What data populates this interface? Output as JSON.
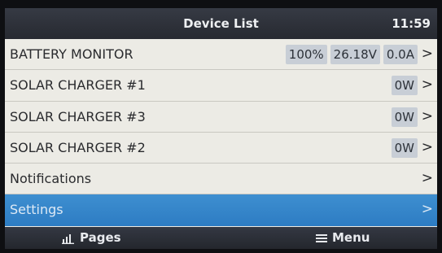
{
  "header": {
    "title": "Device List",
    "clock": "11:59"
  },
  "rows": [
    {
      "label": "BATTERY MONITOR",
      "values": [
        "100%",
        "26.18V",
        "0.0A"
      ],
      "chevron": ">"
    },
    {
      "label": "SOLAR CHARGER #1",
      "values": [
        "0W"
      ],
      "chevron": ">"
    },
    {
      "label": "SOLAR CHARGER #3",
      "values": [
        "0W"
      ],
      "chevron": ">"
    },
    {
      "label": "SOLAR CHARGER #2",
      "values": [
        "0W"
      ],
      "chevron": ">"
    },
    {
      "label": "Notifications",
      "values": [],
      "chevron": ">"
    },
    {
      "label": "Settings",
      "values": [],
      "chevron": ">",
      "selected": true
    }
  ],
  "footer": {
    "pages_label": "Pages",
    "pages_icon": "bar-chart-icon",
    "menu_label": "Menu",
    "menu_icon": "hamburger-menu-icon"
  },
  "colors": {
    "header_bg": "#2b2e35",
    "selected_row": "#3588cb",
    "value_pill": "#c8ced6",
    "list_bg": "#ecebe5"
  }
}
